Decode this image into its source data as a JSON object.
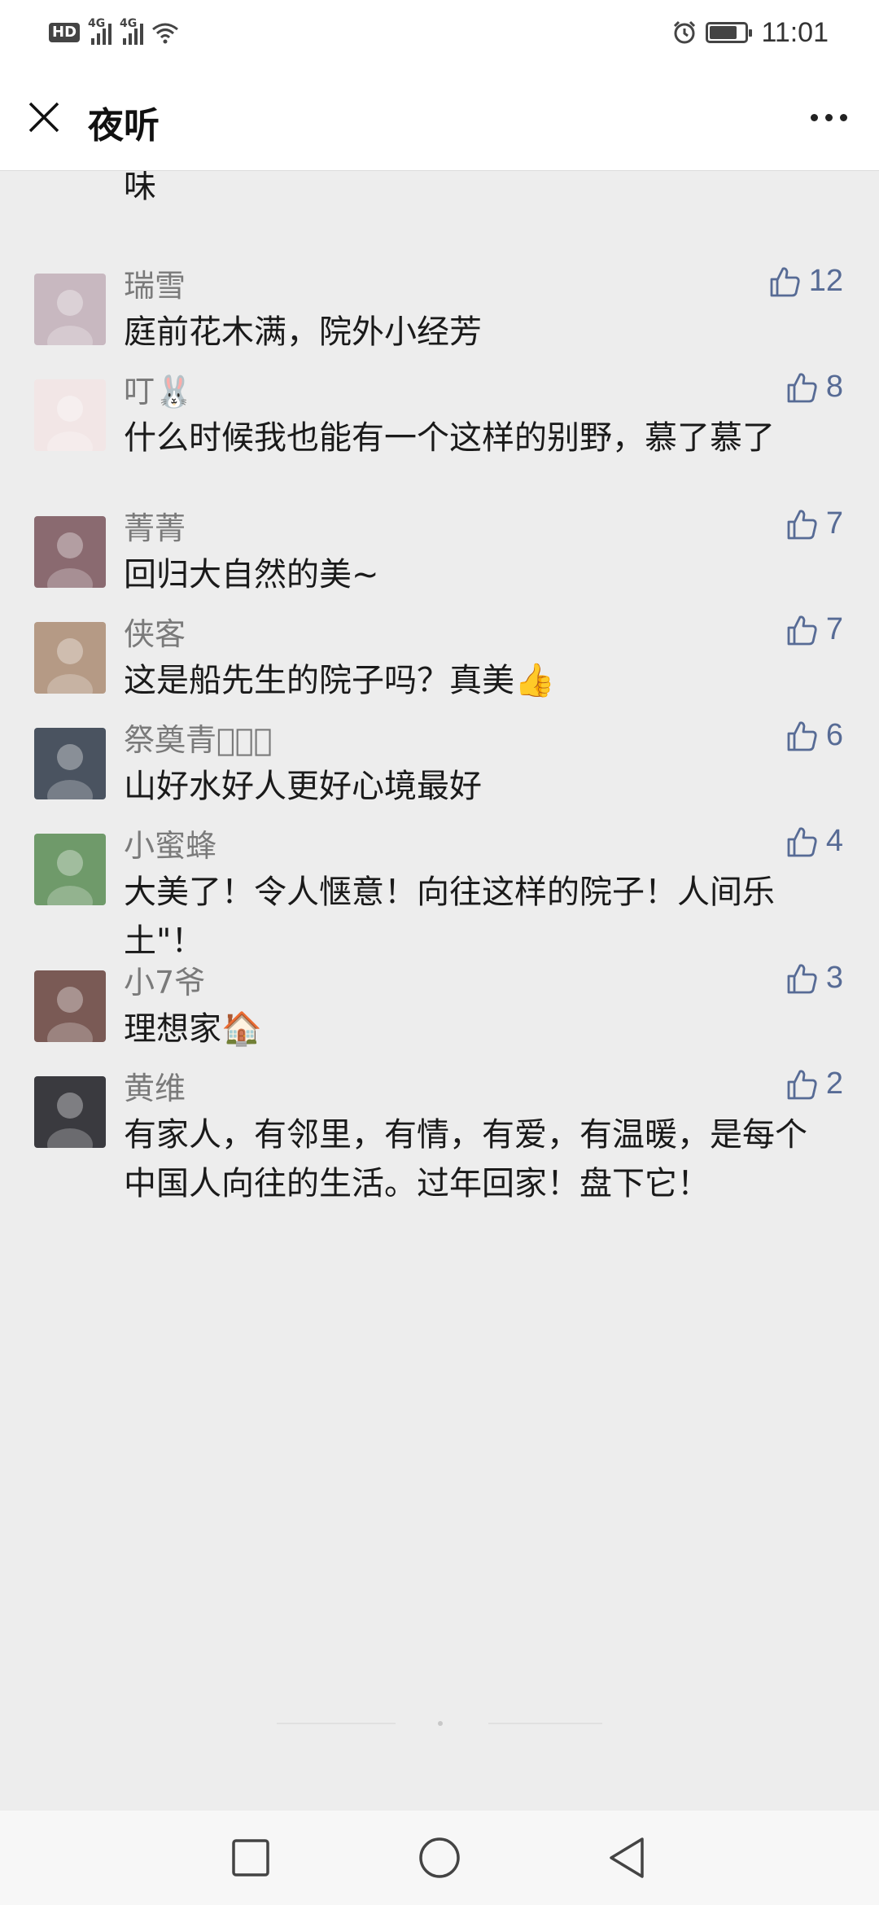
{
  "status_bar": {
    "hd": "HD",
    "sim1": "4G",
    "sim2": "4G",
    "time": "11:01",
    "battery_level": 0.75,
    "icons": [
      "hd-icon",
      "signal-icon",
      "signal-icon",
      "wifi-icon",
      "alarm-icon",
      "battery-icon"
    ]
  },
  "nav": {
    "title": "夜听",
    "close_icon": "close-icon",
    "more_icon": "more-icon"
  },
  "partial_comment_text": "味",
  "comments": [
    {
      "nick": "瑞雪",
      "text": "庭前花木满，院外小经芳",
      "likes": "12",
      "avatar_color": "#c8b8c0"
    },
    {
      "nick": "叮🐰",
      "text": "什么时候我也能有一个这样的别野，慕了慕了",
      "likes": "8",
      "avatar_color": "#f2e6e6"
    },
    {
      "nick": "菁菁",
      "text": "回归大自然的美~",
      "likes": "7",
      "avatar_color": "#8a6a70"
    },
    {
      "nick": "侠客",
      "text": "这是船先生的院子吗？真美👍",
      "likes": "7",
      "avatar_color": "#b59a85"
    },
    {
      "nick": "祭奠青春⃢⃢",
      "text": "山好水好人更好心境最好",
      "likes": "6",
      "avatar_color": "#4a5360"
    },
    {
      "nick": "小蜜蜂",
      "text": "大美了！令人惬意！向往这样的院子！人间乐土\"！",
      "likes": "4",
      "avatar_color": "#6f9a6a"
    },
    {
      "nick": "小7爷",
      "text": "理想家🏠",
      "likes": "3",
      "avatar_color": "#7a5a55"
    },
    {
      "nick": "黄维",
      "text": "有家人，有邻里，有情，有爱，有温暖，是每个中国人向往的生活。过年回家！盘下它！",
      "likes": "2",
      "avatar_color": "#3a3a3f"
    }
  ],
  "colors": {
    "link": "#576b95",
    "nick": "#7a7a7a",
    "background": "#ededed"
  },
  "system_nav": {
    "icons": [
      "recents-icon",
      "home-icon",
      "back-icon"
    ]
  }
}
